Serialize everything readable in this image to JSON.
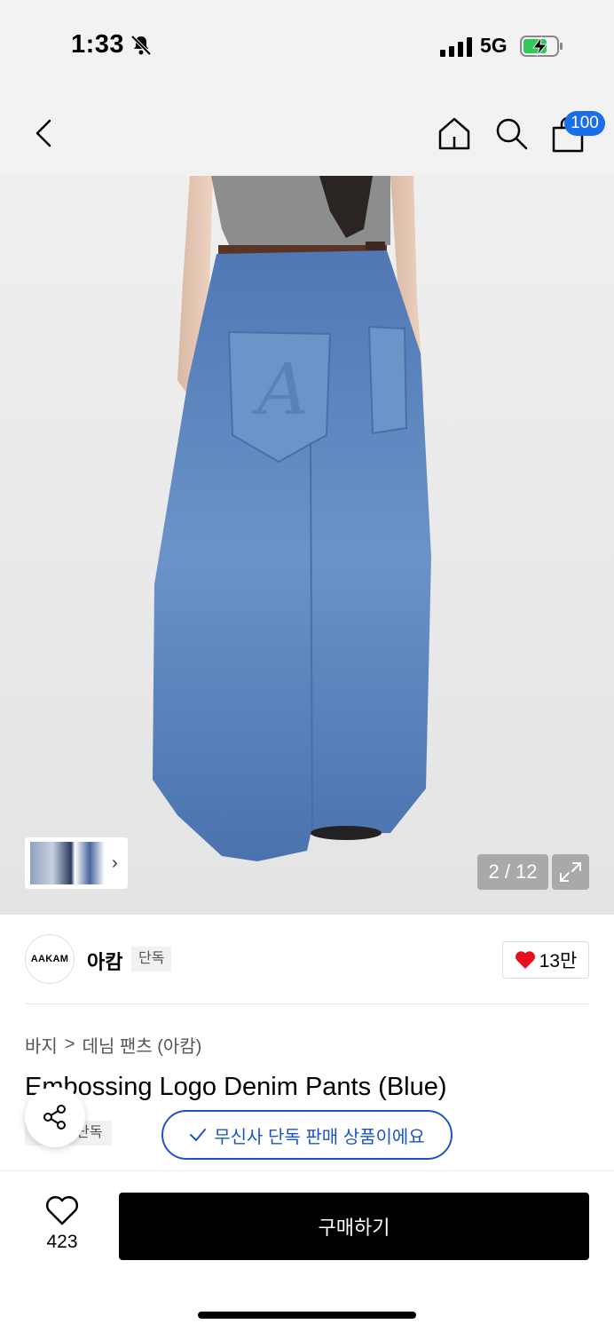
{
  "status": {
    "time": "1:33",
    "network": "5G"
  },
  "header": {
    "cart_badge": "100"
  },
  "gallery": {
    "counter": "2 / 12"
  },
  "brand": {
    "logo_text": "AAKAM",
    "name": "아캄",
    "tag": "단독",
    "likes": "13만"
  },
  "breadcrumb": {
    "category": "바지",
    "separator": ">",
    "subcategory": "데님 팬츠 (아캄)"
  },
  "product": {
    "title": "Embossing Logo Denim Pants (Blue)",
    "tag": "단독",
    "exclusive_notice": "무신사 단독 판매 상품이에요"
  },
  "bottom": {
    "wish_count": "423",
    "buy_label": "구매하기"
  },
  "colors": {
    "accent": "#1a55c8",
    "badge": "#1a6eea",
    "heart": "#e8101e"
  }
}
